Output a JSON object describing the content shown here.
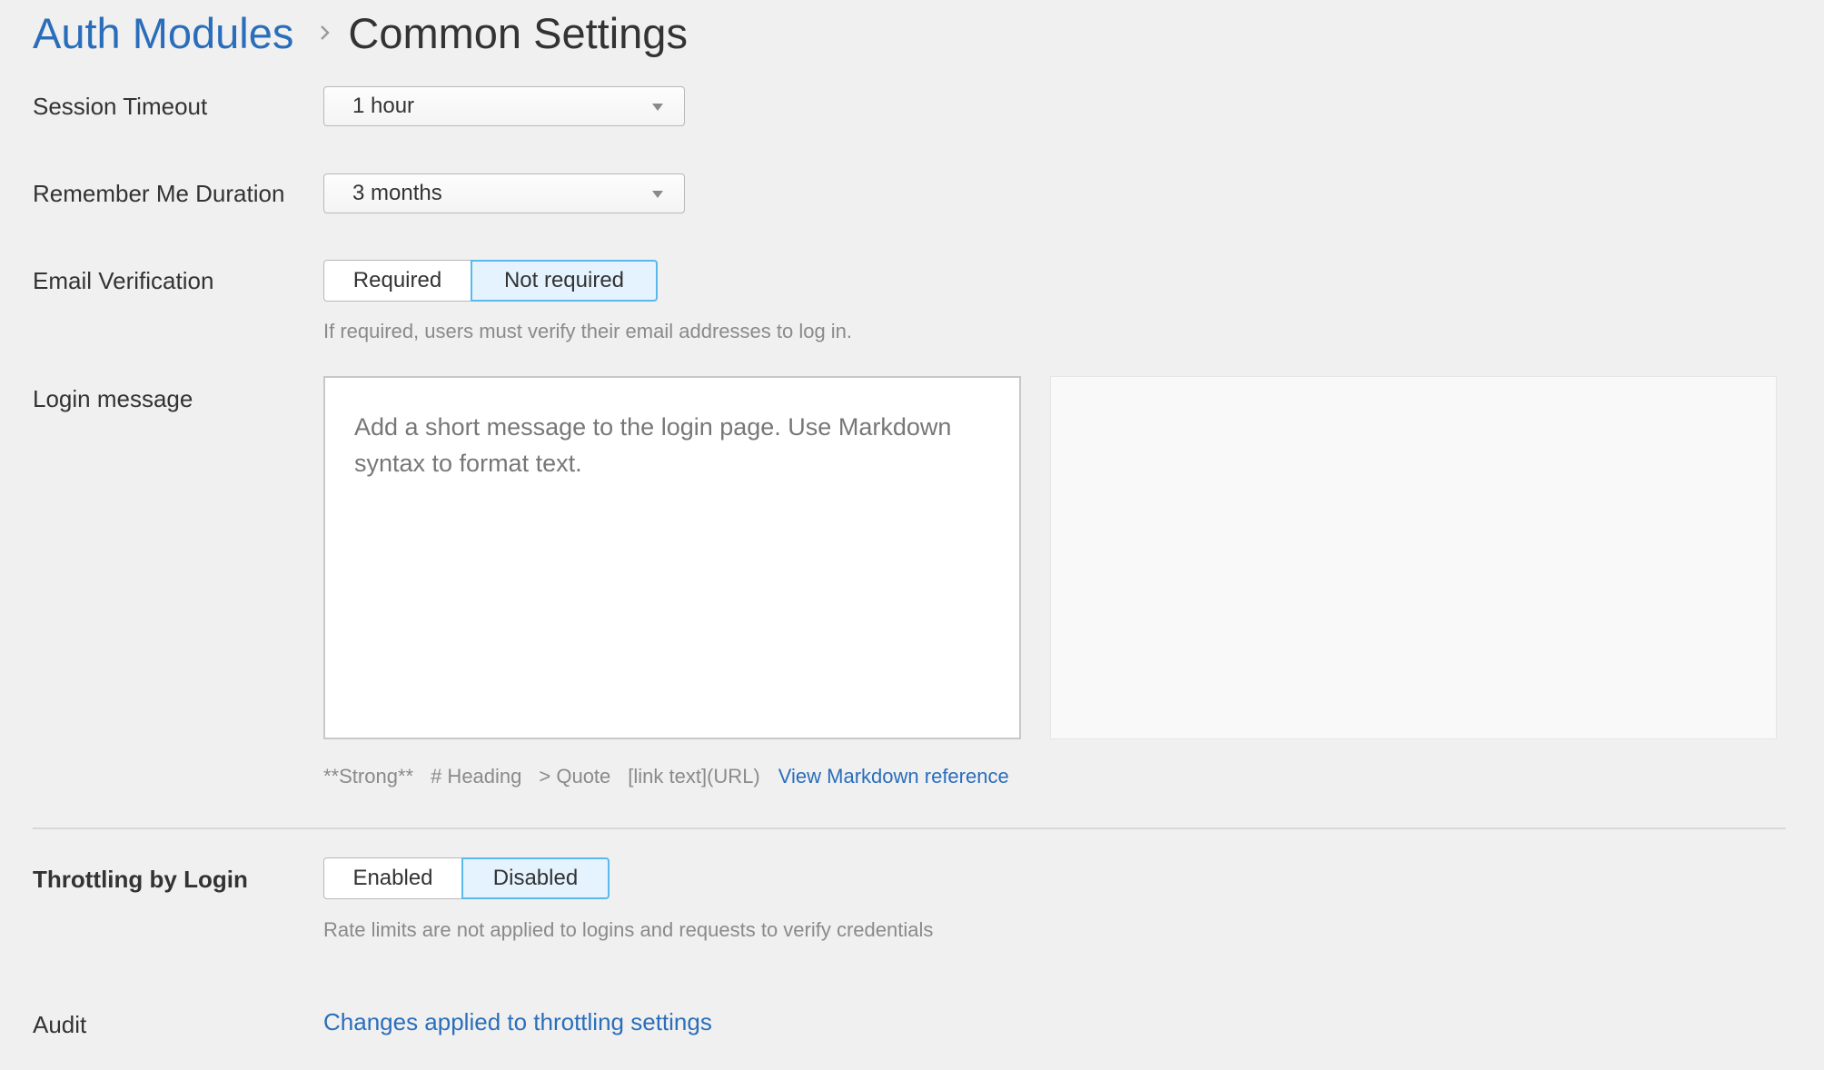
{
  "breadcrumb": {
    "parent": "Auth Modules",
    "current": "Common Settings"
  },
  "session_timeout": {
    "label": "Session Timeout",
    "value": "1 hour"
  },
  "remember_me": {
    "label": "Remember Me Duration",
    "value": "3 months"
  },
  "email_verification": {
    "label": "Email Verification",
    "options": [
      "Required",
      "Not required"
    ],
    "selected": "Not required",
    "help": "If required, users must verify their email addresses to log in."
  },
  "login_message": {
    "label": "Login message",
    "placeholder": "Add a short message to the login page. Use Markdown syntax to format text.",
    "hints": [
      "**Strong**",
      "# Heading",
      "> Quote",
      "[link text](URL)"
    ],
    "reference_link": "View Markdown reference"
  },
  "throttling": {
    "label": "Throttling by Login",
    "options": [
      "Enabled",
      "Disabled"
    ],
    "selected": "Disabled",
    "help": "Rate limits are not applied to logins and requests to verify credentials"
  },
  "audit": {
    "label": "Audit",
    "link": "Changes applied to throttling settings"
  },
  "colors": {
    "background": "#f0f0f0",
    "link": "#2a6ebb",
    "active_toggle_bg": "#e4f3fd",
    "active_toggle_border": "#59b9ea",
    "help_text": "#8a8a8a"
  },
  "icons": {
    "breadcrumb_separator": "chevron-right-icon",
    "select_caret": "caret-down-icon"
  }
}
